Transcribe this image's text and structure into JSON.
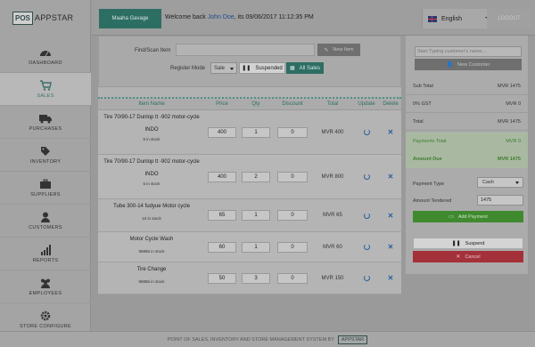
{
  "brand": {
    "pos": "POS",
    "name": "APPSTAR"
  },
  "nav": [
    {
      "label": "DASHBOARD",
      "icon": "dashboard-icon",
      "active": false
    },
    {
      "label": "SALES",
      "icon": "cart-icon",
      "active": true
    },
    {
      "label": "PURCHASES",
      "icon": "truck-icon",
      "active": false
    },
    {
      "label": "INVENTORY",
      "icon": "tag-icon",
      "active": false
    },
    {
      "label": "SUPPLIERS",
      "icon": "briefcase-icon",
      "active": false
    },
    {
      "label": "CUSTOMERS",
      "icon": "user-icon",
      "active": false
    },
    {
      "label": "REPORTS",
      "icon": "bar-chart-icon",
      "active": false
    },
    {
      "label": "EMPLOYEES",
      "icon": "users-icon",
      "active": false
    },
    {
      "label": "STORE CONFIGURE",
      "icon": "gear-icon",
      "active": false
    }
  ],
  "topbar": {
    "shop": "Maaha Gavage",
    "welcome_prefix": "Welcome back ",
    "user": "John Doe",
    "welcome_suffix": ", its  09/06/2017 11:12:35 PM",
    "language": "English",
    "logout": "LOGOUT"
  },
  "search": {
    "find_label": "Find/Scan Item",
    "find_value": "",
    "new_item": "New Item",
    "register_label": "Register Mode",
    "register_mode": "Sale",
    "suspended": "Suspended",
    "all_sales": "All Sales"
  },
  "table": {
    "headers": [
      "Item Name",
      "Price",
      "Qty",
      "Discount",
      "Total",
      "Update",
      "Delete"
    ],
    "rows": [
      {
        "name": "Tire 70/90-17 Dunlop tt -902 motor-cycle",
        "desc": "INDO",
        "stock": "5 in stock",
        "price": "400",
        "qty": "1",
        "discount": "0",
        "total": "MVR 400"
      },
      {
        "name": "Tire 70/90-17 Dunlop tt -902 motor-cycle",
        "desc": "INDO",
        "stock": "5 in stock",
        "price": "400",
        "qty": "2",
        "discount": "0",
        "total": "MVR 800"
      },
      {
        "name": "Tube 300-14 fudyue Motor cycle",
        "desc": "",
        "stock": "10 in stock",
        "price": "65",
        "qty": "1",
        "discount": "0",
        "total": "MVR 65"
      },
      {
        "name": "Motor Cycle Wash",
        "desc": "",
        "stock": "99885 in stock",
        "price": "60",
        "qty": "1",
        "discount": "0",
        "total": "MVR 60"
      },
      {
        "name": "Tire Change",
        "desc": "",
        "stock": "99886 in stock",
        "price": "50",
        "qty": "3",
        "discount": "0",
        "total": "MVR 150"
      }
    ]
  },
  "summary": {
    "customer_placeholder": "Start Typing customer's name...",
    "new_customer": "New Customer",
    "sub_total_label": "Sub Total",
    "sub_total": "MVR 1475",
    "gst_label": "0% GST",
    "gst": "MVR 0",
    "total_label": "Total",
    "total": "MVR 1475",
    "payments_label": "Payments Total",
    "payments": "MVR 0",
    "amount_due_label": "Amount Due",
    "amount_due": "MVR 1475",
    "payment_type_label": "Payment Type",
    "payment_type": "Cash",
    "amount_tendered_label": "Amount Tendered",
    "amount_tendered": "1475",
    "add_payment": "Add Payment",
    "suspend": "Suspend",
    "cancel": "Cancel"
  },
  "footer": {
    "text": "POINT OF SALES, INVENTORY AND STORE MANAGEMENT SYSTEM BY",
    "badge": "APPSTAR"
  },
  "colors": {
    "accent": "#2d6e63",
    "green": "#3f8a2f",
    "red": "#a4313a",
    "link": "#2a5f9e"
  }
}
